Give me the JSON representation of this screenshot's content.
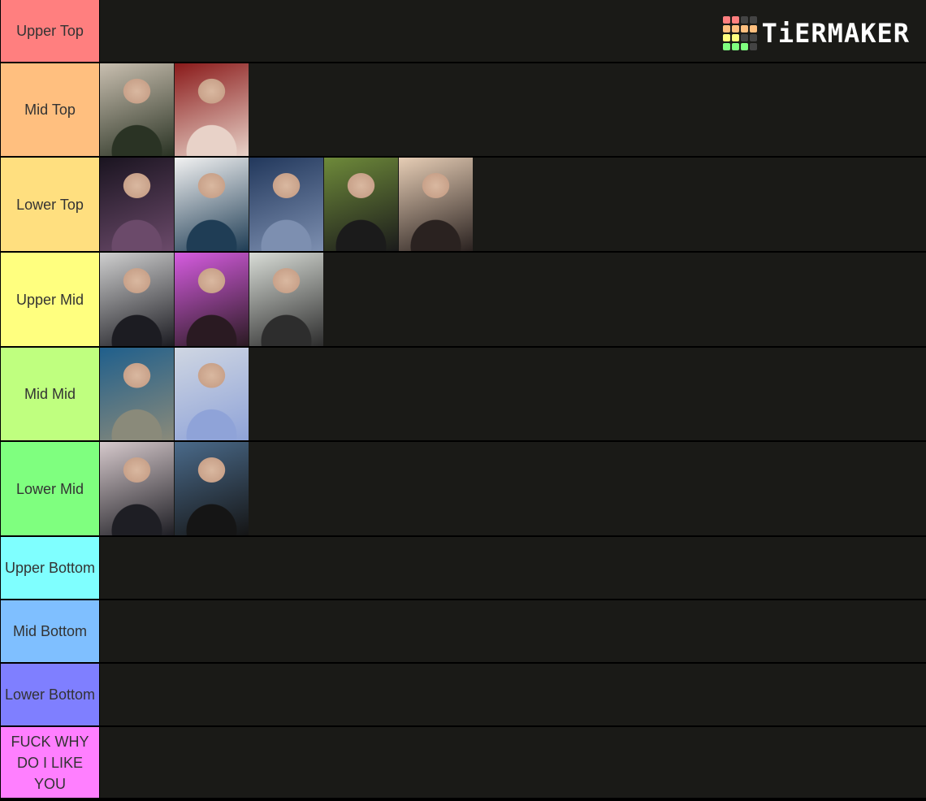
{
  "logo": {
    "text": "TiERMAKER",
    "grid_colors": [
      "#ff7f7f",
      "#ff7f7f",
      "#444444",
      "#444444",
      "#ffbf7f",
      "#ffbf7f",
      "#ffbf7f",
      "#ffbf7f",
      "#ffff7f",
      "#ffff7f",
      "#444444",
      "#444444",
      "#7fff7f",
      "#7fff7f",
      "#7fff7f",
      "#444444"
    ]
  },
  "tiers": [
    {
      "label": "Upper Top",
      "color": "#ff7f7f",
      "height": 78,
      "items": []
    },
    {
      "label": "Mid Top",
      "color": "#ffbf7f",
      "height": 116,
      "items": [
        {
          "name": "man-dark-jacket",
          "bg": [
            "#c9bfb0",
            "#2a3324"
          ]
        },
        {
          "name": "woman-red-background",
          "bg": [
            "#8a1a1a",
            "#e8d2c8"
          ]
        }
      ]
    },
    {
      "label": "Lower Top",
      "color": "#ffdf7f",
      "height": 117,
      "items": [
        {
          "name": "woman-stage-ponytail",
          "bg": [
            "#1a1420",
            "#6b4a6a"
          ]
        },
        {
          "name": "man-hand-to-mouth",
          "bg": [
            "#f2f2f2",
            "#1f3d55"
          ]
        },
        {
          "name": "woman-black-dress",
          "bg": [
            "#22385c",
            "#7d8fb0"
          ]
        },
        {
          "name": "man-black-suit",
          "bg": [
            "#6e8a3a",
            "#1b1b1b"
          ]
        },
        {
          "name": "man-hand-to-chin",
          "bg": [
            "#e6cdb5",
            "#2a2220"
          ]
        }
      ]
    },
    {
      "label": "Upper Mid",
      "color": "#ffff7f",
      "height": 117,
      "items": [
        {
          "name": "man-red-collar",
          "bg": [
            "#cfcfcf",
            "#1c1c22"
          ]
        },
        {
          "name": "man-pink-background",
          "bg": [
            "#d65ce0",
            "#2a1a22"
          ]
        },
        {
          "name": "man-black-tshirt",
          "bg": [
            "#d8dcd6",
            "#2d2d2d"
          ]
        }
      ]
    },
    {
      "label": "Mid Mid",
      "color": "#bfff7f",
      "height": 116,
      "items": [
        {
          "name": "woman-singing-microphone",
          "bg": [
            "#1f5f8c",
            "#8a8a7a"
          ]
        },
        {
          "name": "man-striped-shirt",
          "bg": [
            "#cfd6e2",
            "#8fa3d8"
          ]
        }
      ]
    },
    {
      "label": "Lower Mid",
      "color": "#7fff7f",
      "height": 117,
      "items": [
        {
          "name": "woman-school-uniform",
          "bg": [
            "#d6c9cc",
            "#1e1e24"
          ]
        },
        {
          "name": "man-football-jersey",
          "bg": [
            "#4a6a8a",
            "#151515"
          ]
        }
      ]
    },
    {
      "label": "Upper Bottom",
      "color": "#7fffff",
      "height": 78,
      "items": []
    },
    {
      "label": "Mid Bottom",
      "color": "#7fbfff",
      "height": 78,
      "items": []
    },
    {
      "label": "Lower Bottom",
      "color": "#7f7fff",
      "height": 78,
      "items": []
    },
    {
      "label": "FUCK WHY DO I LIKE YOU",
      "color": "#ff7fff",
      "height": 89,
      "items": []
    }
  ]
}
